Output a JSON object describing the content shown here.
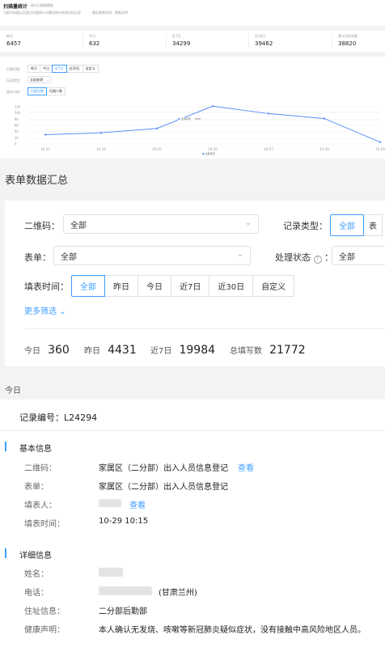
{
  "header": {
    "title": "扫描量统计",
    "subtitle": "统计扫描量数据",
    "desc1": "当前扫码量以页面访问量统计计算",
    "desc2": "仅统计有效扫码记录",
    "desc3": "最近更新时间",
    "note": "更新说明"
  },
  "stats": [
    {
      "label": "昨日",
      "value": "6457"
    },
    {
      "label": "今日",
      "value": "632"
    },
    {
      "label": "近7日",
      "value": "34299"
    },
    {
      "label": "近30日",
      "value": "39462"
    },
    {
      "label": "累计扫码次数",
      "value": "38820"
    }
  ],
  "chart_panel": {
    "time_label": "日期范围：",
    "time_tabs": [
      "昨日",
      "今日",
      "近7日",
      "近30日",
      "自定义"
    ],
    "time_active": 2,
    "qr_label": "扫码类型：",
    "qr_value": "全部来源",
    "stat_label": "统计口径：",
    "stat_tabs": [
      "扫描次数",
      "扫描人数"
    ],
    "stat_active": 0,
    "tooltip_label": "全部来源",
    "tooltip_value": "3000"
  },
  "chart_data": {
    "type": "line",
    "categories": [
      "10-23",
      "10-24",
      "10-25",
      "10-26",
      "10-27",
      "10-28",
      "10-29"
    ],
    "series": [
      {
        "name": "全部来源",
        "values": [
          3000,
          3600,
          5000,
          12200,
          9800,
          8200,
          600
        ]
      }
    ],
    "ylim": [
      0,
      12000
    ],
    "yticks": [
      "12k",
      "10k",
      "8k",
      "6k",
      "4k",
      "2k",
      "0"
    ],
    "legend": "bottom",
    "grid": true,
    "color": "#5b8ff9"
  },
  "summary": {
    "section_title": "表单数据汇总",
    "qr_label": "二维码：",
    "qr_value": "全部",
    "record_type_label": "记录类型：",
    "record_type_tabs": [
      "全部",
      "表"
    ],
    "form_label": "表单：",
    "form_value": "全部",
    "status_label": "处理状态",
    "status_value": "全部",
    "fill_time_label": "填表时间：",
    "fill_tabs": [
      "全部",
      "昨日",
      "今日",
      "近7日",
      "近30日",
      "自定义"
    ],
    "more_filter": "更多筛选",
    "counts": [
      {
        "label": "今日",
        "value": "360"
      },
      {
        "label": "昨日",
        "value": "4431"
      },
      {
        "label": "近7日",
        "value": "19984"
      },
      {
        "label": "总填写数",
        "value": "21772"
      }
    ]
  },
  "list": {
    "group_label": "今日",
    "record_label": "记录编号：L24294",
    "basic_title": "基本信息",
    "basic_rows": [
      {
        "label": "二维码：",
        "value": "家属区（二分部）出入人员信息登记",
        "link": "查看"
      },
      {
        "label": "表单：",
        "value": "家属区（二分部）出入人员信息登记",
        "link": ""
      },
      {
        "label": "填表人：",
        "value": "",
        "link": "查看"
      },
      {
        "label": "填表时间：",
        "value": "10-29 10:15",
        "link": ""
      }
    ],
    "detail_title": "详细信息",
    "detail_rows": [
      {
        "label": "姓名：",
        "value": ""
      },
      {
        "label": "电话：",
        "value": "(甘肃兰州)"
      },
      {
        "label": "住址信息：",
        "value": "二分部后勤部"
      },
      {
        "label": "健康声明：",
        "value": "本人确认无发烧、咳嗽等新冠肺炎疑似症状，没有接触中高风险地区人员。"
      }
    ]
  }
}
